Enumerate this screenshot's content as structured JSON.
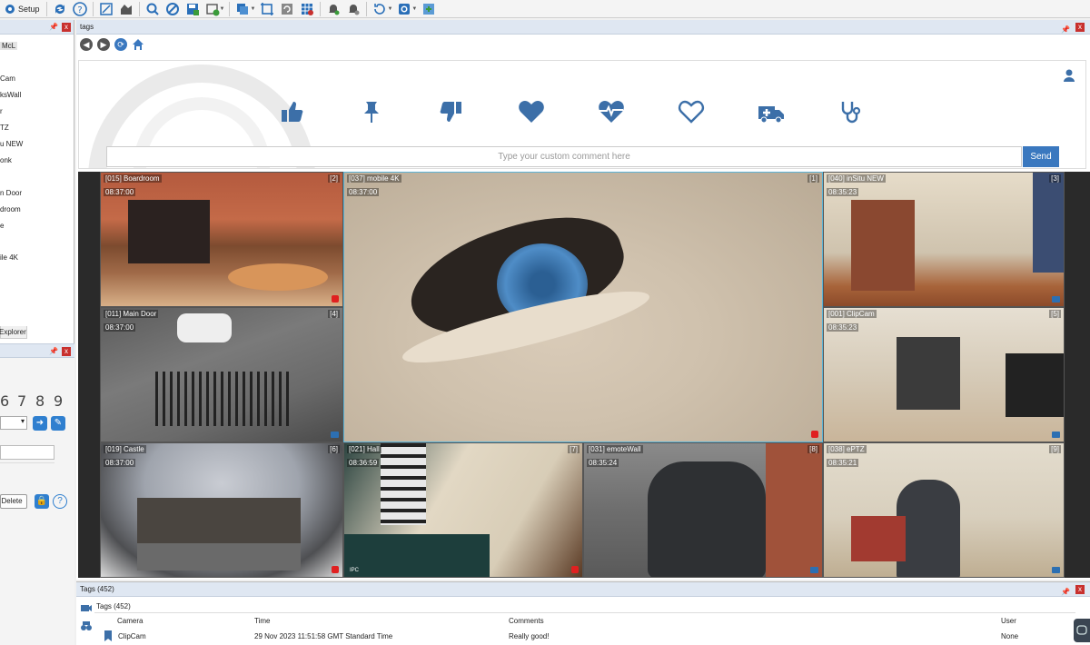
{
  "toolbar": {
    "setup_label": "Setup",
    "icons": [
      "gear-icon",
      "sync-icon",
      "help-icon",
      "fullscreen-icon",
      "layout-icon",
      "search-icon",
      "block-icon",
      "save-icon",
      "add-icon",
      "layers-icon",
      "crop-icon",
      "rotate-icon",
      "grid-icon",
      "alarm-icon",
      "alarm-off-icon",
      "refresh-icon",
      "camera-icon",
      "export-icon"
    ]
  },
  "left_panel": {
    "header_text": "McL",
    "cameras": [
      "Cam",
      "ksWall",
      "r",
      "TZ",
      "u NEW",
      "onk",
      "n Door",
      "droom",
      "e",
      "ile 4K"
    ],
    "explorer_tab": "Explorer",
    "ptz": {
      "digits": [
        "6",
        "7",
        "8",
        "9"
      ],
      "delete_label": "Delete"
    }
  },
  "main": {
    "header_title": "tags",
    "comment_placeholder": "Type your custom comment here",
    "send_label": "Send",
    "tag_icons": [
      "thumbs-up-icon",
      "pin-icon",
      "thumbs-down-icon",
      "heart-icon",
      "heartbeat-icon",
      "heart-outline-icon",
      "ambulance-icon",
      "stethoscope-icon"
    ]
  },
  "video_wall": {
    "tiles": [
      {
        "label": "[015] Boardroom",
        "time": "08:37:00",
        "num": "[2]"
      },
      {
        "label": "[037] mobile 4K",
        "time": "08:37:00",
        "num": "[1]"
      },
      {
        "label": "[040] inSitu NEW",
        "time": "08:35:23",
        "num": "[3]"
      },
      {
        "label": "[011] Main Door",
        "time": "08:37:00",
        "num": "[4]"
      },
      {
        "label": "[001] ClipCam",
        "time": "08:35:23",
        "num": "[5]"
      },
      {
        "label": "[019] Castle",
        "time": "08:37:00",
        "num": "[6]"
      },
      {
        "label": "[021] Hall",
        "time": "08:36:59",
        "num": "[7]"
      },
      {
        "label": "[031] emoteWall",
        "time": "08:35:24",
        "num": "[8]"
      },
      {
        "label": "[038] ePTZ",
        "time": "08:35:21",
        "num": "[9]"
      }
    ],
    "ipc_label": "IPC"
  },
  "bottom": {
    "header_title": "Tags (452)",
    "sub_title": "Tags (452)",
    "columns": [
      "Camera",
      "Time",
      "Comments",
      "User"
    ],
    "row": {
      "camera": "ClipCam",
      "time": "29 Nov 2023 11:51:58  GMT Standard Time",
      "comments": "Really good!",
      "user": "None"
    }
  },
  "colors": {
    "accent": "#3a78bf",
    "icon_blue": "#3c6fa8",
    "panel_header": "#dfe7f2",
    "close_red": "#c8302e"
  }
}
